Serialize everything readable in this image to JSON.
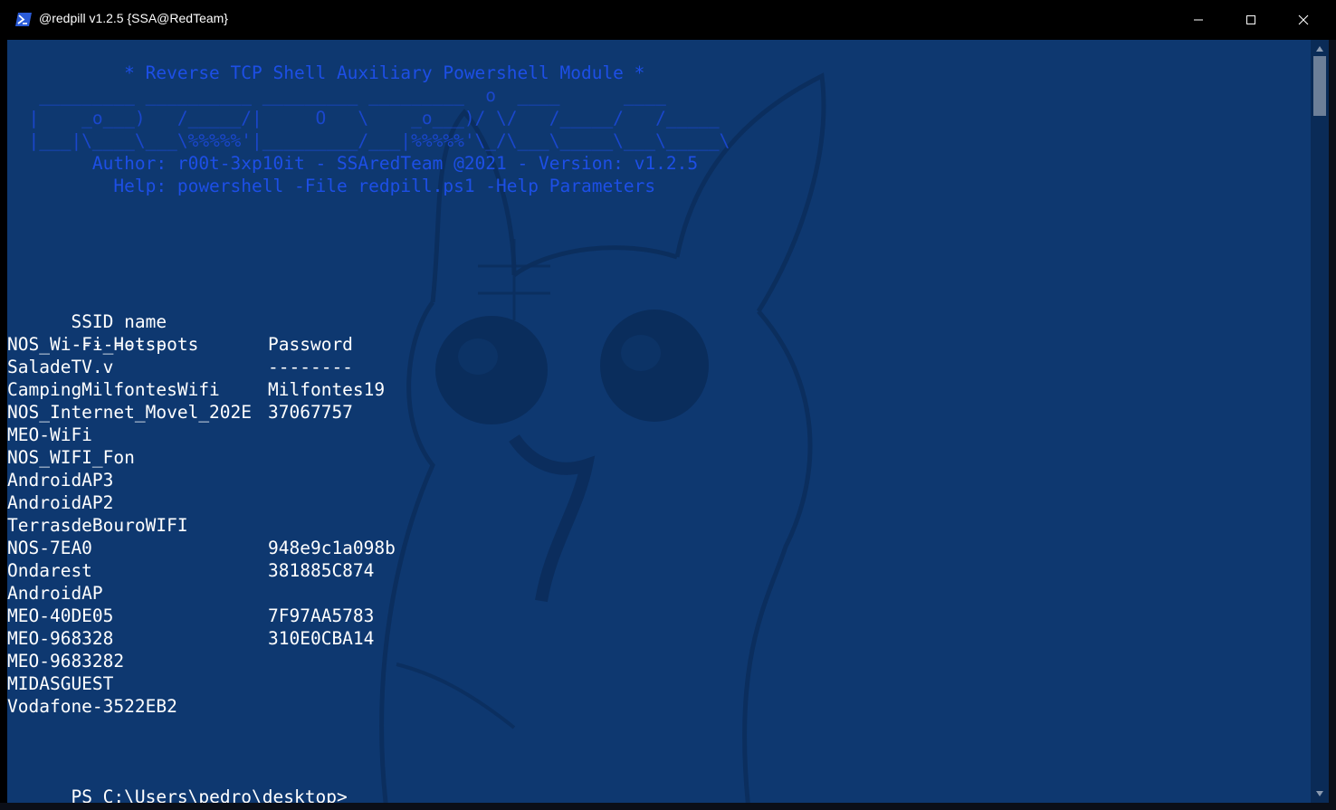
{
  "window": {
    "title": "@redpill v1.2.5 {SSA@RedTeam}",
    "app_icon": "powershell-icon",
    "controls": [
      "minimize-icon",
      "maximize-icon",
      "close-icon"
    ]
  },
  "banner": {
    "line1": "           * Reverse TCP Shell Auxiliary Powershell Module *",
    "line2": "   _________ __________ _________ _________  o  ____      ____",
    "line3": "  |    _o___)   /_____/|     O   \\    _o___)/ \\/   /_____/   /_____",
    "line4": "  |___|\\____\\___\\%%%%%'|_________/___|%%%%%'\\_/\\___\\_____\\___\\_____\\",
    "line5": "        Author: r00t-3xp10it - SSAredTeam @2021 - Version: v1.2.5",
    "line6": "          Help: powershell -File redpill.ps1 -Help Parameters"
  },
  "table": {
    "headers": {
      "ssid": "SSID name",
      "password": "Password"
    },
    "underlines": {
      "ssid": "---------",
      "password": "--------"
    },
    "rows": [
      {
        "ssid": "NOS_Wi-Fi_Hotspots",
        "password": ""
      },
      {
        "ssid": "SaladeTV.v",
        "password": ""
      },
      {
        "ssid": "CampingMilfontesWifi",
        "password": "Milfontes19"
      },
      {
        "ssid": "NOS_Internet_Movel_202E",
        "password": "37067757"
      },
      {
        "ssid": "MEO-WiFi",
        "password": ""
      },
      {
        "ssid": "NOS_WIFI_Fon",
        "password": ""
      },
      {
        "ssid": "AndroidAP3",
        "password": ""
      },
      {
        "ssid": "AndroidAP2",
        "password": ""
      },
      {
        "ssid": "TerrasdeBouroWIFI",
        "password": ""
      },
      {
        "ssid": "NOS-7EA0",
        "password": "948e9c1a098b"
      },
      {
        "ssid": "Ondarest",
        "password": "381885C874"
      },
      {
        "ssid": "AndroidAP",
        "password": ""
      },
      {
        "ssid": "MEO-40DE05",
        "password": "7F97AA5783"
      },
      {
        "ssid": "MEO-968328",
        "password": "310E0CBA14"
      },
      {
        "ssid": "MEO-9683282",
        "password": ""
      },
      {
        "ssid": "MIDASGUEST",
        "password": ""
      },
      {
        "ssid": "Vodafone-3522EB2",
        "password": ""
      }
    ]
  },
  "prompt": "PS C:\\Users\\pedro\\desktop>",
  "colors": {
    "console_background": "#0e3870",
    "banner_text": "#1d4fe6",
    "output_text": "#ffffff",
    "titlebar": "#000000",
    "scroll_thumb": "#6d7f98"
  }
}
